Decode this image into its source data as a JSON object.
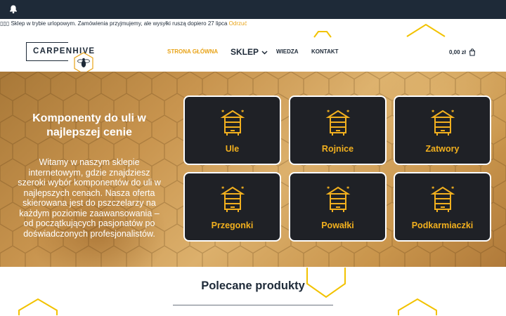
{
  "notice": {
    "icons": "▯▯▯",
    "text": "Sklep w trybie urlopowym. Zamówienia przyjmujemy, ale wysyłki ruszą dopiero 27 lipca",
    "dismiss": "Odrzuć"
  },
  "header": {
    "logo_text": "CARPENHIVE",
    "nav": {
      "home": "STRONA GŁÓWNA",
      "shop": "SKLEP",
      "knowledge": "WIEDZA",
      "contact": "KONTAKT"
    },
    "cart_total": "0,00 zł"
  },
  "hero": {
    "title": "Komponenty do uli w najlepszej cenie",
    "text": "Witamy w naszym sklepie internetowym, gdzie znajdziesz szeroki wybór komponentów do uli w najlepszych cenach. Nasza oferta skierowana jest do pszczelarzy na każdym poziomie zaawansowania – od początkujących pasjonatów po doświadczonych profesjonalistów."
  },
  "categories": [
    {
      "label": "Ule"
    },
    {
      "label": "Rojnice"
    },
    {
      "label": "Zatwory"
    },
    {
      "label": "Przegonki"
    },
    {
      "label": "Powałki"
    },
    {
      "label": "Podkarmiaczki"
    }
  ],
  "featured": {
    "title": "Polecane produkty"
  },
  "colors": {
    "accent": "#e8a317",
    "dark": "#1e2a38",
    "card_bg": "#1f2126",
    "card_text": "#f2b01e"
  }
}
